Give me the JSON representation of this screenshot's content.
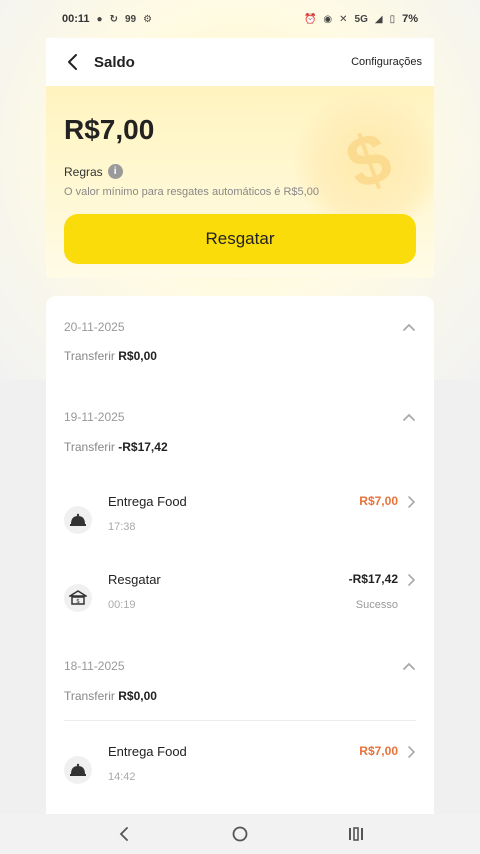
{
  "status_bar": {
    "time": "00:11",
    "left_icons": [
      "c-icon",
      "alarm-loop-icon",
      "99-icon",
      "gear-icon"
    ],
    "left_glyph_text": "99",
    "battery": "7%",
    "network": "5G"
  },
  "header": {
    "title": "Saldo",
    "config_label": "Configurações"
  },
  "balance": {
    "amount": "R$7,00",
    "rules_label": "Regras",
    "rules_desc": "O valor mínimo para resgates automáticos é R$5,00",
    "redeem_label": "Resgatar"
  },
  "groups": [
    {
      "date": "20-11-2025",
      "transfer_label": "Transferir",
      "transfer_value": "R$0,00"
    },
    {
      "date": "19-11-2025",
      "transfer_label": "Transferir",
      "transfer_value": "-R$17,42",
      "items": [
        {
          "name": "Entrega Food",
          "time": "17:38",
          "amount": "R$7,00",
          "status": ""
        },
        {
          "name": "Resgatar",
          "time": "00:19",
          "amount": "-R$17,42",
          "status": "Sucesso"
        }
      ]
    },
    {
      "date": "18-11-2025",
      "transfer_label": "Transferir",
      "transfer_value": "R$0,00",
      "items": [
        {
          "name": "Entrega Food",
          "time": "14:42",
          "amount": "R$7,00",
          "status": ""
        }
      ]
    }
  ],
  "colors": {
    "accent_yellow": "#fadc0a",
    "positive_amount": "#e8733a"
  }
}
